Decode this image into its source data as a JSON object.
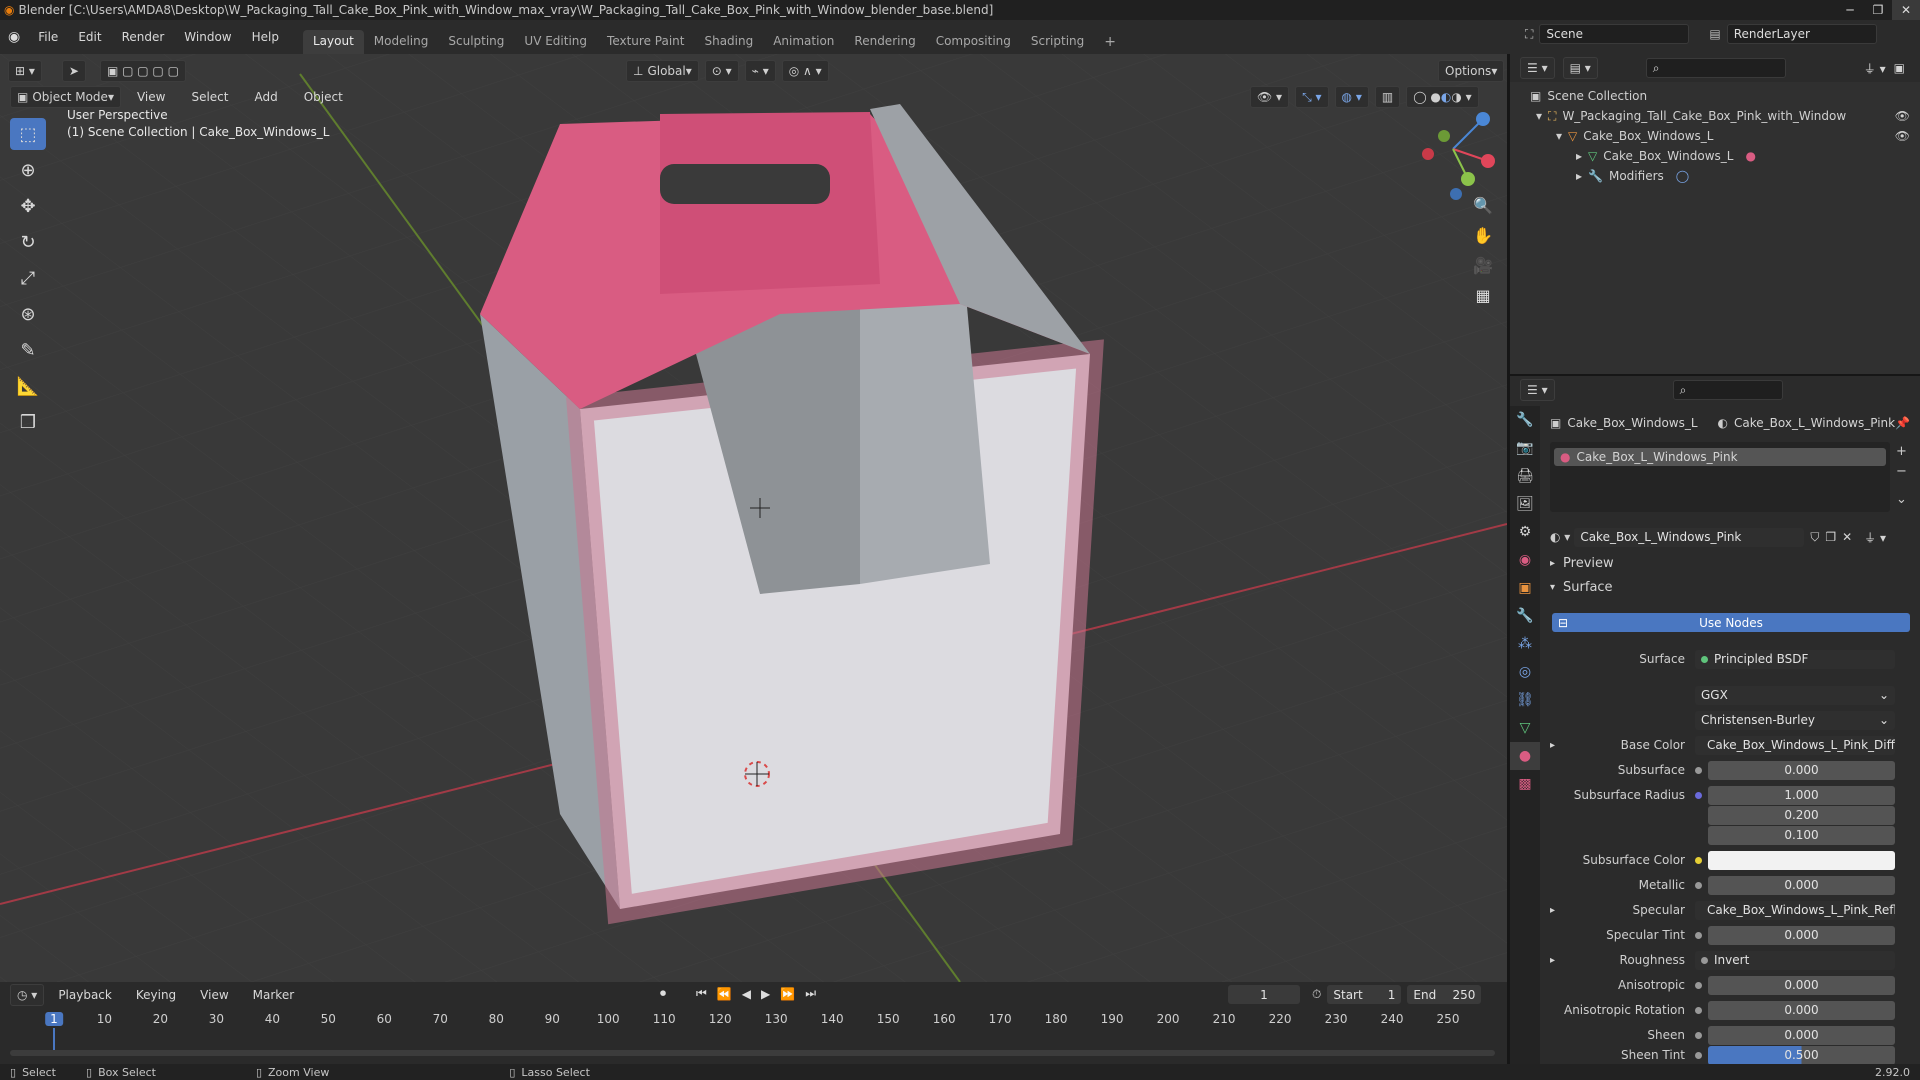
{
  "window": {
    "title": "Blender [C:\\Users\\AMDA8\\Desktop\\W_Packaging_Tall_Cake_Box_Pink_with_Window_max_vray\\W_Packaging_Tall_Cake_Box_Pink_with_Window_blender_base.blend]"
  },
  "menubar": {
    "menus": [
      "File",
      "Edit",
      "Render",
      "Window",
      "Help"
    ],
    "workspaces": [
      "Layout",
      "Modeling",
      "Sculpting",
      "UV Editing",
      "Texture Paint",
      "Shading",
      "Animation",
      "Rendering",
      "Compositing",
      "Scripting"
    ],
    "active_workspace": "Layout",
    "scene": "Scene",
    "view_layer": "RenderLayer"
  },
  "viewport": {
    "mode": "Object Mode",
    "menus": [
      "View",
      "Select",
      "Add",
      "Object"
    ],
    "transform_orientation": "Global",
    "options_label": "Options",
    "perspective_label": "User Perspective",
    "collection_label": "(1) Scene Collection | Cake_Box_Windows_L"
  },
  "outliner": {
    "rows": [
      {
        "label": "Scene Collection",
        "indent": 0
      },
      {
        "label": "W_Packaging_Tall_Cake_Box_Pink_with_Window",
        "indent": 1
      },
      {
        "label": "Cake_Box_Windows_L",
        "indent": 2
      },
      {
        "label": "Cake_Box_Windows_L",
        "indent": 3
      },
      {
        "label": "Modifiers",
        "indent": 3
      }
    ]
  },
  "properties": {
    "breadcrumb_object": "Cake_Box_Windows_L",
    "breadcrumb_material": "Cake_Box_L_Windows_Pink",
    "slot_name": "Cake_Box_L_Windows_Pink",
    "material_name": "Cake_Box_L_Windows_Pink",
    "panel_preview": "Preview",
    "panel_surface": "Surface",
    "use_nodes": "Use Nodes",
    "surface_label": "Surface",
    "surface_value": "Principled BSDF",
    "distribution": "GGX",
    "subsurface_method": "Christensen-Burley",
    "fields": {
      "base_color_label": "Base Color",
      "base_color_value": "Cake_Box_Windows_L_Pink_Diffuse...",
      "subsurface_label": "Subsurface",
      "subsurface_value": "0.000",
      "subsurface_radius_label": "Subsurface Radius",
      "subsurface_radius_1": "1.000",
      "subsurface_radius_2": "0.200",
      "subsurface_radius_3": "0.100",
      "subsurface_color_label": "Subsurface Color",
      "metallic_label": "Metallic",
      "metallic_value": "0.000",
      "specular_label": "Specular",
      "specular_value": "Cake_Box_Windows_L_Pink_Reflec...",
      "specular_tint_label": "Specular Tint",
      "specular_tint_value": "0.000",
      "roughness_label": "Roughness",
      "roughness_value": "Invert",
      "anisotropic_label": "Anisotropic",
      "anisotropic_value": "0.000",
      "anisotropic_rotation_label": "Anisotropic Rotation",
      "anisotropic_rotation_value": "0.000",
      "sheen_label": "Sheen",
      "sheen_value": "0.000",
      "sheen_tint_label": "Sheen Tint",
      "sheen_tint_value": "0.500"
    }
  },
  "timeline": {
    "menus": [
      "Playback",
      "Keying",
      "View",
      "Marker"
    ],
    "current_frame": "1",
    "start_label": "Start",
    "start_value": "1",
    "end_label": "End",
    "end_value": "250",
    "ticks": [
      "1",
      "10",
      "20",
      "30",
      "40",
      "50",
      "60",
      "70",
      "80",
      "90",
      "100",
      "110",
      "120",
      "130",
      "140",
      "150",
      "160",
      "170",
      "180",
      "190",
      "200",
      "210",
      "220",
      "230",
      "240",
      "250"
    ]
  },
  "statusbar": {
    "select": "Select",
    "box_select": "Box Select",
    "zoom_view": "Zoom View",
    "lasso_select": "Lasso Select",
    "version": "2.92.0"
  },
  "colors": {
    "accent_blue": "#4a77c1",
    "box_pink": "#d95c82",
    "x_axis": "#e0465a",
    "y_axis": "#8bc34a",
    "z_axis": "#4a87d6"
  }
}
